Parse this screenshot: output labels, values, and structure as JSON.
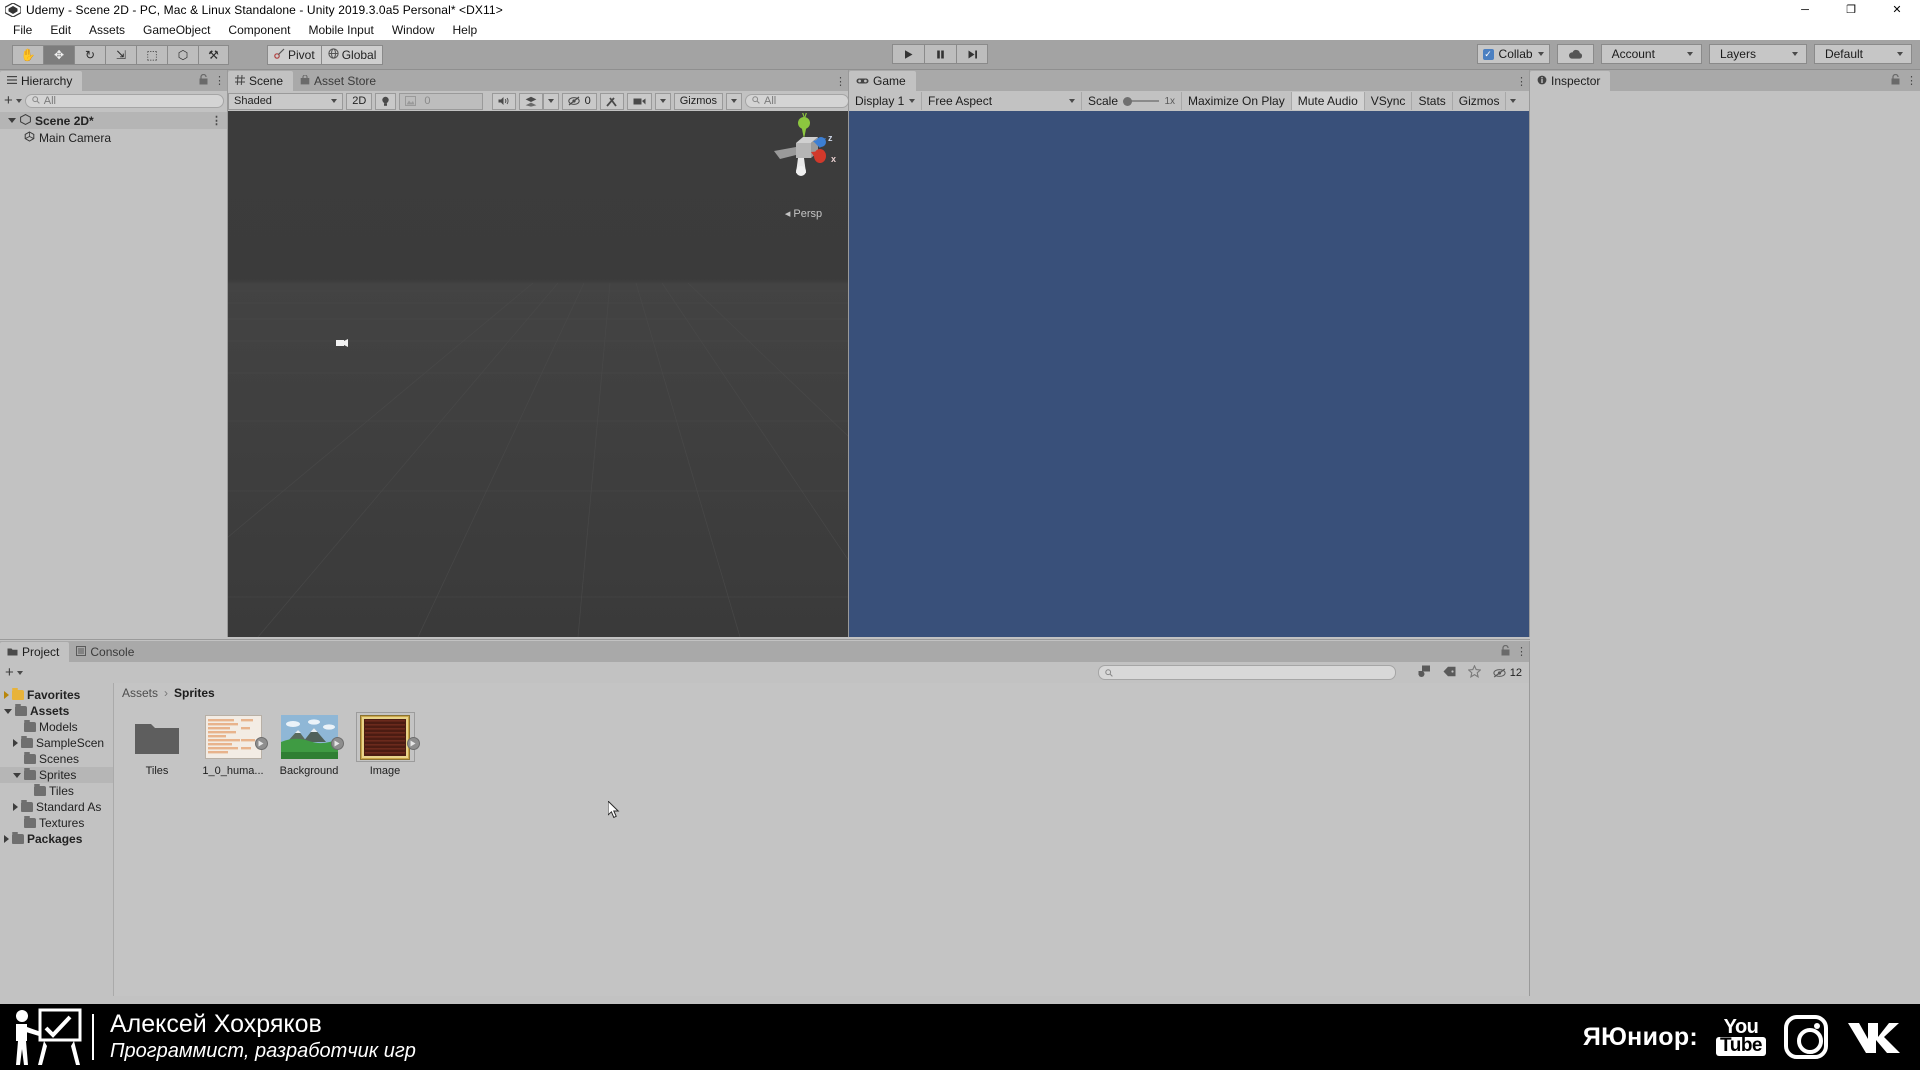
{
  "window": {
    "title": "Udemy - Scene 2D - PC, Mac & Linux Standalone - Unity 2019.3.0a5 Personal* <DX11>",
    "minimize": "─",
    "maximize": "❐",
    "close": "✕"
  },
  "menu": {
    "items": [
      "File",
      "Edit",
      "Assets",
      "GameObject",
      "Component",
      "Mobile Input",
      "Window",
      "Help"
    ]
  },
  "toolbar": {
    "tools": [
      {
        "name": "hand-tool",
        "glyph": "✋"
      },
      {
        "name": "move-tool",
        "glyph": "✥"
      },
      {
        "name": "rotate-tool",
        "glyph": "↻"
      },
      {
        "name": "scale-tool",
        "glyph": "⇲"
      },
      {
        "name": "rect-tool",
        "glyph": "⬚"
      },
      {
        "name": "transform-tool",
        "glyph": "⬡"
      },
      {
        "name": "custom-tool",
        "glyph": "⚒"
      }
    ],
    "pivot_label": "Pivot",
    "global_label": "Global",
    "play": "▶",
    "pause": "❘❘",
    "step": "▶❘",
    "collab_label": "Collab",
    "cloud_label": "☁",
    "account_label": "Account",
    "layers_label": "Layers",
    "layout_label": "Default"
  },
  "hierarchy": {
    "tab": "Hierarchy",
    "add_label": "+",
    "search_placeholder": "All",
    "rows": [
      {
        "label": "Scene 2D*",
        "type": "scene",
        "depth": 0
      },
      {
        "label": "Main Camera",
        "type": "gameobject",
        "depth": 1
      }
    ]
  },
  "scene": {
    "tab": "Scene",
    "tab_secondary": "Asset Store",
    "shading_mode": "Shaded",
    "mode_2d": "2D",
    "light_icon": "☀",
    "fx_value": "0",
    "audio_icon": "◂)",
    "effects_icon": "❖",
    "hidden_count": "0",
    "tools_icon": "⚒",
    "camera_icon": "■",
    "gizmos_label": "Gizmos",
    "search_placeholder": "All",
    "persp_label": "Persp",
    "axis_y": "y",
    "axis_z": "z",
    "axis_x": "x"
  },
  "game": {
    "tab": "Game",
    "display": "Display 1",
    "aspect": "Free Aspect",
    "scale_label": "Scale",
    "scale_value": "1x",
    "maximize_on_play": "Maximize On Play",
    "mute_audio": "Mute Audio",
    "vsync": "VSync",
    "stats": "Stats",
    "gizmos": "Gizmos",
    "background_color": "#39507a"
  },
  "inspector": {
    "tab": "Inspector"
  },
  "project": {
    "tab": "Project",
    "tab_secondary": "Console",
    "add_label": "+",
    "search_placeholder": "",
    "visible_count": "12",
    "breadcrumb": [
      "Assets",
      "Sprites"
    ],
    "tree": [
      {
        "label": "Favorites",
        "depth": 0,
        "bold": true,
        "arrow": "right",
        "fav": true
      },
      {
        "label": "Assets",
        "depth": 0,
        "bold": true,
        "arrow": "down",
        "fav": false
      },
      {
        "label": "Models",
        "depth": 1,
        "bold": false,
        "arrow": "none",
        "fav": false
      },
      {
        "label": "SampleScen",
        "depth": 1,
        "bold": false,
        "arrow": "right",
        "fav": false
      },
      {
        "label": "Scenes",
        "depth": 1,
        "bold": false,
        "arrow": "none",
        "fav": false
      },
      {
        "label": "Sprites",
        "depth": 1,
        "bold": false,
        "arrow": "down",
        "fav": false,
        "selected": true
      },
      {
        "label": "Tiles",
        "depth": 2,
        "bold": false,
        "arrow": "none",
        "fav": false
      },
      {
        "label": "Standard As",
        "depth": 1,
        "bold": false,
        "arrow": "right",
        "fav": false
      },
      {
        "label": "Textures",
        "depth": 1,
        "bold": false,
        "arrow": "none",
        "fav": false
      },
      {
        "label": "Packages",
        "depth": 0,
        "bold": true,
        "arrow": "right",
        "fav": false
      }
    ],
    "assets": [
      {
        "label": "Tiles",
        "kind": "folder"
      },
      {
        "label": "1_0_huma...",
        "kind": "sprite-sheet"
      },
      {
        "label": "Background",
        "kind": "background"
      },
      {
        "label": "Image",
        "kind": "image"
      }
    ]
  },
  "overlay": {
    "name": "Алексей Хохряков",
    "role": "Программист, разработчик игр",
    "brand": "ЯЮниор:",
    "youtube_top": "You",
    "youtube_bottom": "Tube",
    "vk": "VK"
  }
}
